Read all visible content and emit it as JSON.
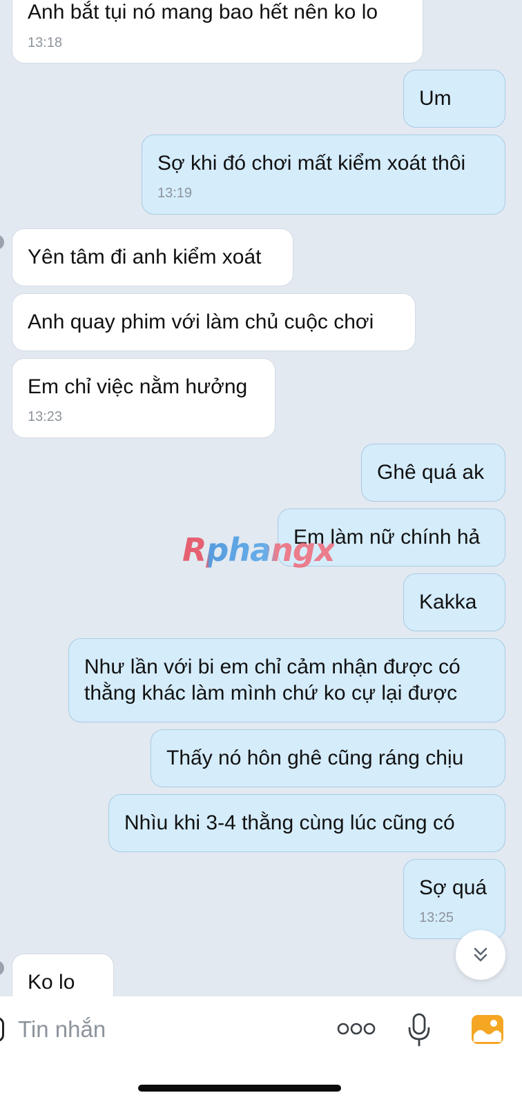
{
  "conversation": {
    "messages": [
      {
        "text": "Anh bắt tụi nó mang bao hết nên ko lo",
        "time": "13:18"
      },
      {
        "text": "Um"
      },
      {
        "text": "Sợ khi đó chơi mất kiểm xoát thôi",
        "time": "13:19"
      },
      {
        "text": "Yên tâm đi anh kiểm xoát"
      },
      {
        "text": "Anh quay phim với làm chủ cuộc chơi"
      },
      {
        "text": "Em chỉ việc nằm hưởng",
        "time": "13:23"
      },
      {
        "text": "Ghê quá ak"
      },
      {
        "text": "Em làm nữ chính hả"
      },
      {
        "text": "Kakka"
      },
      {
        "lines": [
          "Như lần với bi em chỉ cảm nhận được có",
          "thằng khác làm mình chứ ko cự lại được"
        ]
      },
      {
        "text": "Thấy nó hôn ghê cũng ráng chịu"
      },
      {
        "text": "Nhìu khi 3-4 thằng cùng lúc cũng có"
      },
      {
        "text": "Sợ quá",
        "time": "13:25"
      },
      {
        "text": "Ko lo"
      }
    ]
  },
  "watermark": {
    "text": "Rphangx"
  },
  "composer": {
    "placeholder": "Tin nhắn",
    "icons": [
      "more-icon",
      "microphone-icon",
      "image-gallery-icon"
    ]
  },
  "scroll_button": {
    "icon": "chevron-double-down-icon"
  },
  "colors": {
    "background": "#e2e9f1",
    "incoming_bubble": "#ffffff",
    "outgoing_bubble": "#d5ecfb",
    "outgoing_border": "#a9cbe2",
    "timestamp": "#8c939b",
    "gallery_icon": "#f5a623"
  }
}
